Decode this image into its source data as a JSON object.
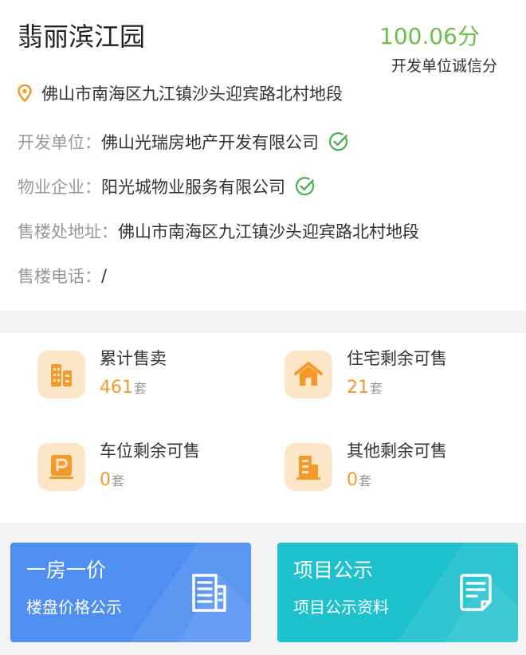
{
  "project": {
    "name": "翡丽滨江园",
    "score_value": "100.06分",
    "score_label": "开发单位诚信分",
    "address": "佛山市南海区九江镇沙头迎宾路北村地段"
  },
  "details": {
    "developer_label": "开发单位：",
    "developer_value": "佛山光瑞房地产开发有限公司",
    "property_label": "物业企业：",
    "property_value": "阳光城物业服务有限公司",
    "sales_address_label": "售楼处地址：",
    "sales_address_value": "佛山市南海区九江镇沙头迎宾路北村地段",
    "phone_label": "售楼电话：",
    "phone_value": "/"
  },
  "stats": [
    {
      "label": "累计售卖",
      "value": "461",
      "unit": "套",
      "icon": "building-icon"
    },
    {
      "label": "住宅剩余可售",
      "value": "21",
      "unit": "套",
      "icon": "house-icon"
    },
    {
      "label": "车位剩余可售",
      "value": "0",
      "unit": "套",
      "icon": "parking-icon"
    },
    {
      "label": "其他剩余可售",
      "value": "0",
      "unit": "套",
      "icon": "office-icon"
    }
  ],
  "actions": {
    "price": {
      "title": "一房一价",
      "subtitle": "楼盘价格公示",
      "icon": "document-list-icon"
    },
    "publicity": {
      "title": "项目公示",
      "subtitle": "项目公示资料",
      "icon": "document-notice-icon"
    }
  },
  "colors": {
    "score": "#6cc04a",
    "verified": "#4caf50",
    "accent_orange": "#f39a2b",
    "icon_bg": "#fde5c8",
    "button_blue": "#4f8ff2",
    "button_teal": "#1ec2cf"
  }
}
